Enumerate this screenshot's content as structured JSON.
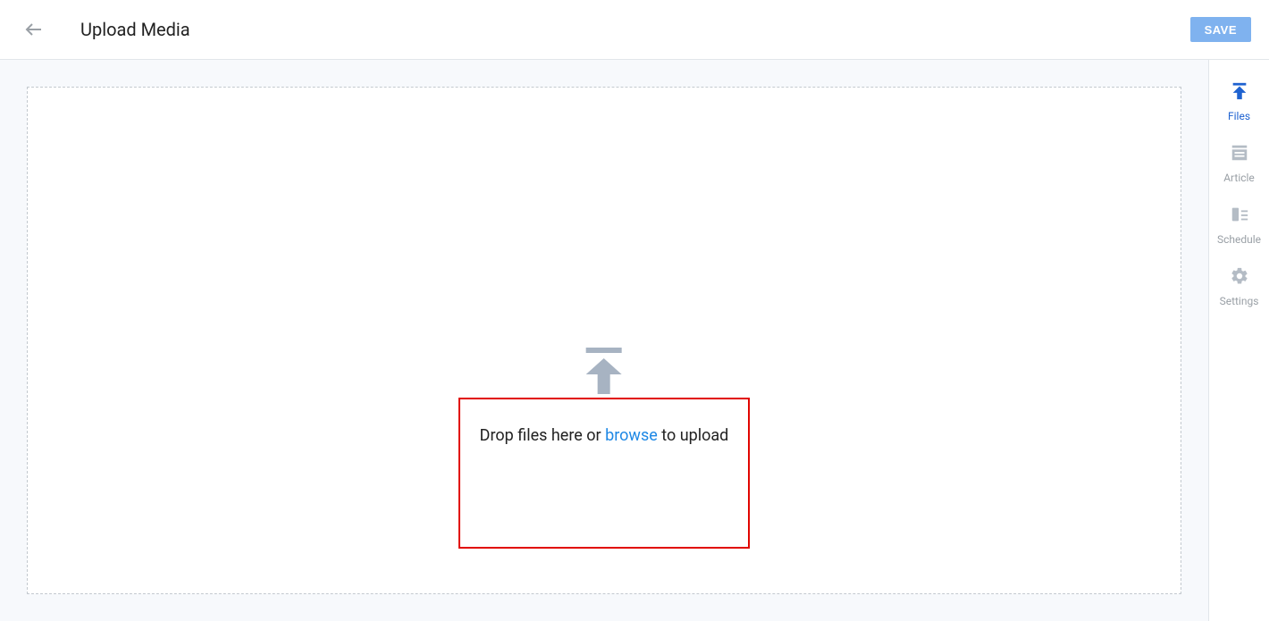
{
  "header": {
    "title": "Upload Media",
    "save_label": "SAVE"
  },
  "dropzone": {
    "text_prefix": "Drop files here or ",
    "browse_label": "browse",
    "text_suffix": " to upload"
  },
  "sidebar": {
    "items": [
      {
        "label": "Files",
        "icon": "upload-icon",
        "active": true
      },
      {
        "label": "Article",
        "icon": "article-icon",
        "active": false
      },
      {
        "label": "Schedule",
        "icon": "schedule-icon",
        "active": false
      },
      {
        "label": "Settings",
        "icon": "settings-icon",
        "active": false
      }
    ]
  }
}
